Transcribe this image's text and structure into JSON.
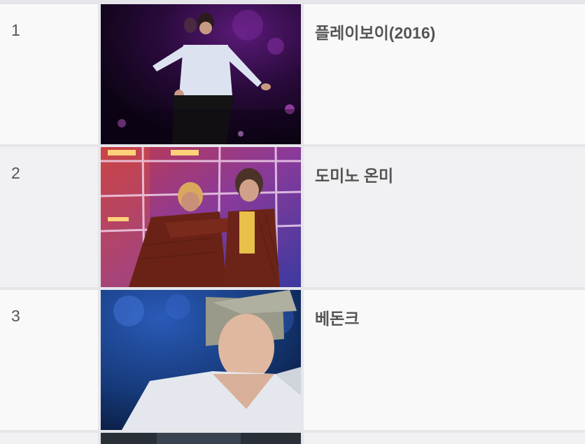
{
  "ranking": {
    "rows": [
      {
        "rank": "1",
        "title": "플레이보이(2016)",
        "thumbnail": "concert-photo-white-shirt-stage"
      },
      {
        "rank": "2",
        "title": "도미노 온미",
        "thumbnail": "concert-photo-two-performers-leather-jackets"
      },
      {
        "rank": "3",
        "title": "베돈크",
        "thumbnail": "concert-photo-wet-white-shirt-blue-stage"
      },
      {
        "rank": "",
        "title": "",
        "thumbnail": "concert-photo-partial"
      }
    ]
  },
  "colors": {
    "row_light": "#f9f9fa",
    "row_dark": "#f1f1f3",
    "divider": "#e6e6ea",
    "text": "#555555"
  }
}
